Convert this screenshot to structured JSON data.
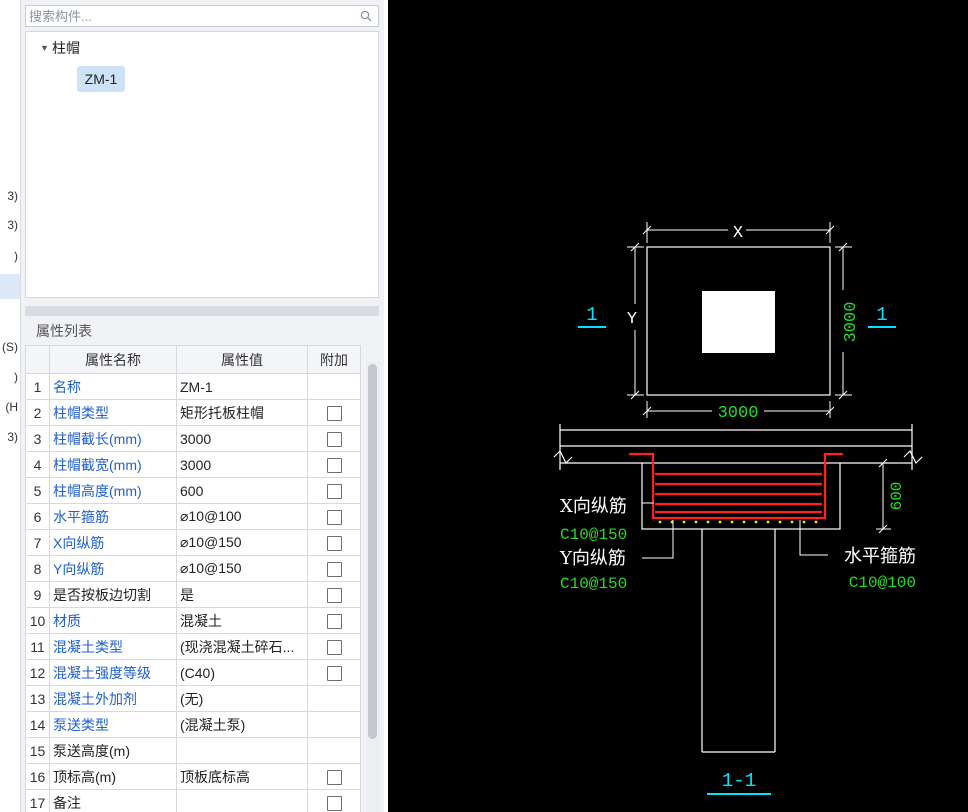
{
  "left_strip": {
    "fragments": [
      "3)",
      "3)",
      ")",
      "(S)",
      ")",
      "(H",
      "3)"
    ]
  },
  "search": {
    "placeholder": "搜索构件..."
  },
  "tree": {
    "group_label": "柱帽",
    "child_label": "ZM-1"
  },
  "properties": {
    "title": "属性列表",
    "headers": {
      "name": "属性名称",
      "value": "属性值",
      "extra": "附加"
    },
    "rows": [
      {
        "idx": "1",
        "name": "名称",
        "value": "ZM-1",
        "link": true,
        "checkbox": false
      },
      {
        "idx": "2",
        "name": "柱帽类型",
        "value": "矩形托板柱帽",
        "link": true,
        "checkbox": true
      },
      {
        "idx": "3",
        "name": "柱帽截长(mm)",
        "value": "3000",
        "link": true,
        "checkbox": true
      },
      {
        "idx": "4",
        "name": "柱帽截宽(mm)",
        "value": "3000",
        "link": true,
        "checkbox": true
      },
      {
        "idx": "5",
        "name": "柱帽高度(mm)",
        "value": "600",
        "link": true,
        "checkbox": true
      },
      {
        "idx": "6",
        "name": "水平箍筋",
        "value": "⌀10@100",
        "link": true,
        "checkbox": true
      },
      {
        "idx": "7",
        "name": "X向纵筋",
        "value": "⌀10@150",
        "link": true,
        "checkbox": true
      },
      {
        "idx": "8",
        "name": "Y向纵筋",
        "value": "⌀10@150",
        "link": true,
        "checkbox": true
      },
      {
        "idx": "9",
        "name": "是否按板边切割",
        "value": "是",
        "link": false,
        "checkbox": true
      },
      {
        "idx": "10",
        "name": "材质",
        "value": "混凝土",
        "link": true,
        "checkbox": true
      },
      {
        "idx": "11",
        "name": "混凝土类型",
        "value": "(现浇混凝土碎石...",
        "link": true,
        "checkbox": true
      },
      {
        "idx": "12",
        "name": "混凝土强度等级",
        "value": "(C40)",
        "link": true,
        "checkbox": true
      },
      {
        "idx": "13",
        "name": "混凝土外加剂",
        "value": "(无)",
        "link": true,
        "checkbox": false
      },
      {
        "idx": "14",
        "name": "泵送类型",
        "value": "(混凝土泵)",
        "link": true,
        "checkbox": false
      },
      {
        "idx": "15",
        "name": "泵送高度(m)",
        "value": "",
        "link": false,
        "checkbox": false
      },
      {
        "idx": "16",
        "name": "顶标高(m)",
        "value": "顶板底标高",
        "link": false,
        "checkbox": true
      },
      {
        "idx": "17",
        "name": "备注",
        "value": "",
        "link": false,
        "checkbox": true
      }
    ]
  },
  "drawing": {
    "plan": {
      "dim_x_label": "X",
      "dim_y_label": "Y",
      "dim_bottom": "3000",
      "dim_right": "3000",
      "section_mark_left": "1",
      "section_mark_right": "1"
    },
    "section": {
      "dim_height": "600",
      "x_rebar_label": "X向纵筋",
      "x_rebar_spec": "C10@150",
      "y_rebar_label": "Y向纵筋",
      "y_rebar_spec": "C10@150",
      "stirrup_label": "水平箍筋",
      "stirrup_spec": "C10@100",
      "section_title": "1-1"
    },
    "colors": {
      "background": "#000000",
      "line": "#ffffff",
      "dimension_text": "#22dd22",
      "section_mark": "#00e5ff",
      "rebar": "#ff2020",
      "dots": "#ffe000"
    }
  }
}
